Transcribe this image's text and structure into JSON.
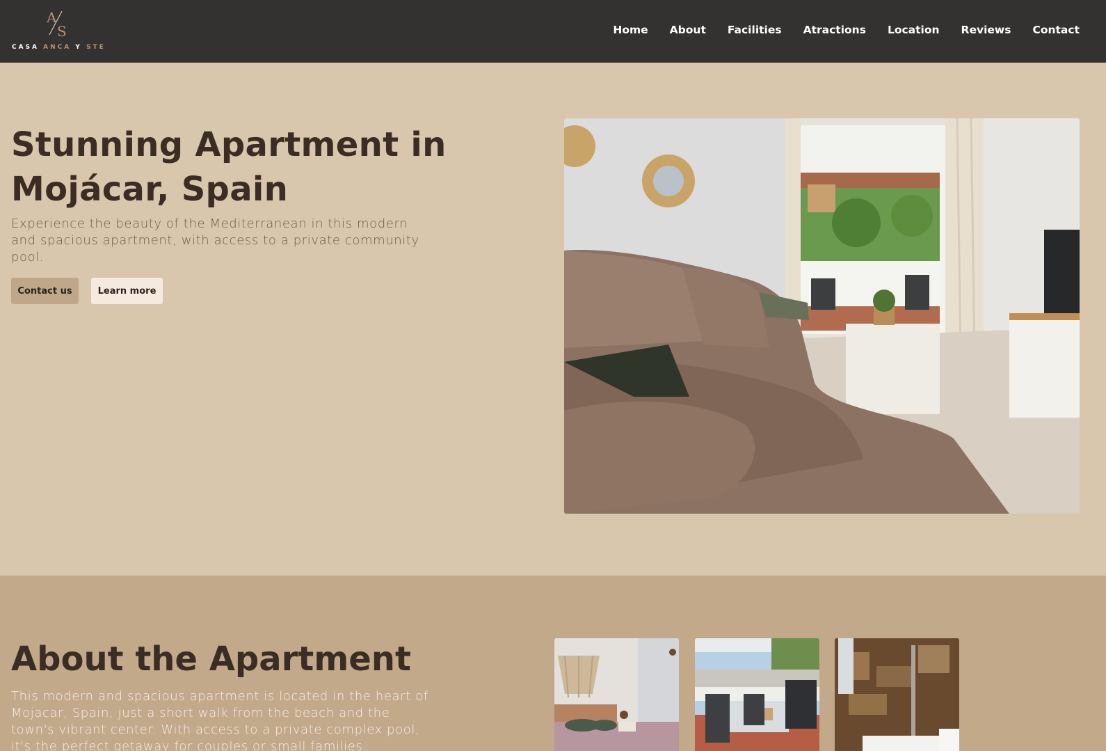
{
  "brand": {
    "monogram": "A/S",
    "word1": "CASA",
    "word2": "ANCA",
    "word3": "Y",
    "word4": "STE"
  },
  "nav": [
    {
      "label": "Home"
    },
    {
      "label": "About"
    },
    {
      "label": "Facilities"
    },
    {
      "label": "Atractions"
    },
    {
      "label": "Location"
    },
    {
      "label": "Reviews"
    },
    {
      "label": "Contact"
    }
  ],
  "hero": {
    "title": "Stunning Apartment in Mojácar, Spain",
    "subtitle": "Experience the beauty of the Mediterranean in this modern and spacious apartment, with access to a private community pool.",
    "contact_button": "Contact us",
    "learn_button": "Learn more",
    "image": "living-room-photo"
  },
  "about": {
    "title": "About the Apartment",
    "text": "This modern and spacious apartment is located in the heart of Mojacar, Spain, just a short walk from the beach and the town's vibrant center. With access to a private complex pool, it's the perfect getaway for couples or small families.",
    "images": [
      "bedroom-photo",
      "terrace-photo",
      "bathroom-photo"
    ]
  },
  "colors": {
    "header_bg": "#333231",
    "hero_bg": "#d8c7ad",
    "about_bg": "#c2a98a",
    "heading": "#3c2d24",
    "accent": "#b39573"
  }
}
